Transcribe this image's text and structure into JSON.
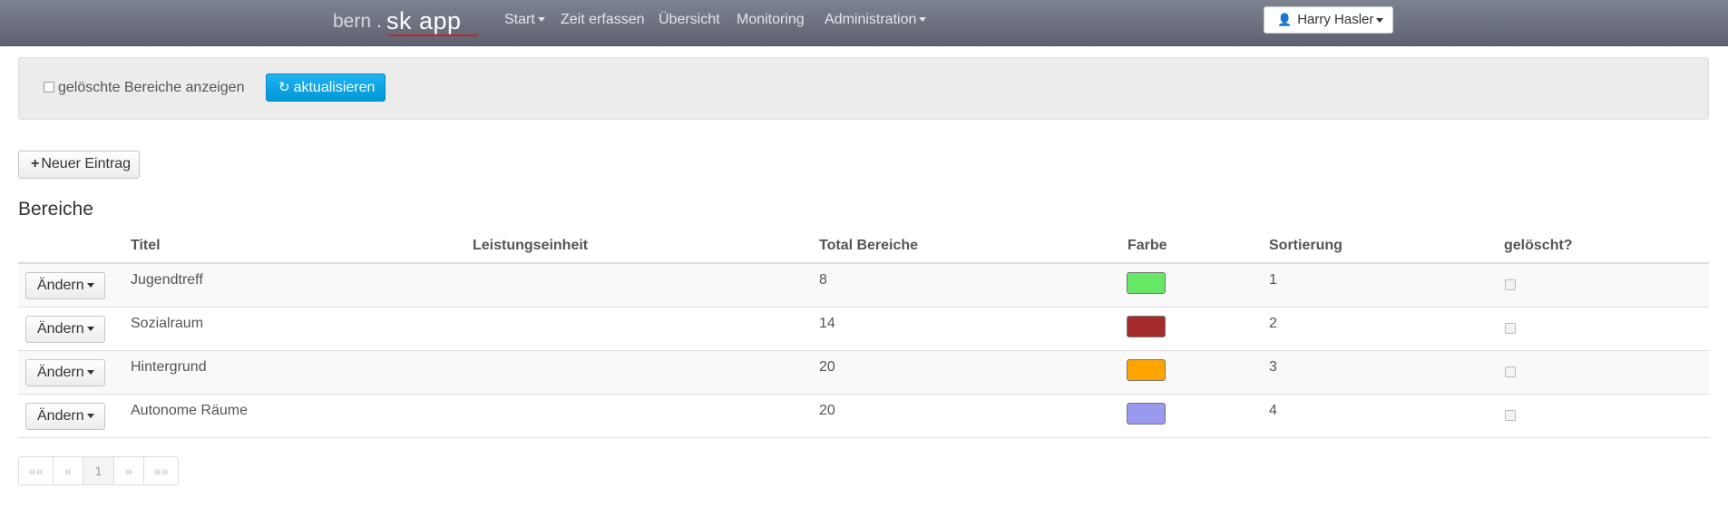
{
  "navbar": {
    "brand_prefix": "bern",
    "brand_dot": ".",
    "brand_name": "sk app",
    "items": [
      {
        "label": "Start",
        "dropdown": true
      },
      {
        "label": "Zeit erfassen",
        "dropdown": false
      },
      {
        "label": "Übersicht",
        "dropdown": false
      },
      {
        "label": "Monitoring",
        "dropdown": false
      },
      {
        "label": "Administration",
        "dropdown": true
      }
    ],
    "user": "Harry Hasler"
  },
  "filter": {
    "show_deleted_label": "gelöschte Bereiche anzeigen",
    "show_deleted_checked": false,
    "refresh_label": "aktualisieren"
  },
  "new_entry_label": "Neuer Eintrag",
  "section_title": "Bereiche",
  "table": {
    "columns": [
      "Titel",
      "Leistungseinheit",
      "Total Bereiche",
      "Farbe",
      "Sortierung",
      "gelöscht?"
    ],
    "action_label": "Ändern",
    "rows": [
      {
        "titel": "Jugendtreff",
        "leistungseinheit": "",
        "total": "8",
        "farbe": "#66e866",
        "sortierung": "1",
        "geloescht": false
      },
      {
        "titel": "Sozialraum",
        "leistungseinheit": "",
        "total": "14",
        "farbe": "#a52a2a",
        "sortierung": "2",
        "geloescht": false
      },
      {
        "titel": "Hintergrund",
        "leistungseinheit": "",
        "total": "20",
        "farbe": "#ffa500",
        "sortierung": "3",
        "geloescht": false
      },
      {
        "titel": "Autonome Räume",
        "leistungseinheit": "",
        "total": "20",
        "farbe": "#9999ee",
        "sortierung": "4",
        "geloescht": false
      }
    ]
  },
  "pagination": {
    "first": "««",
    "prev": "«",
    "current": "1",
    "next": "»",
    "last": "»»"
  }
}
